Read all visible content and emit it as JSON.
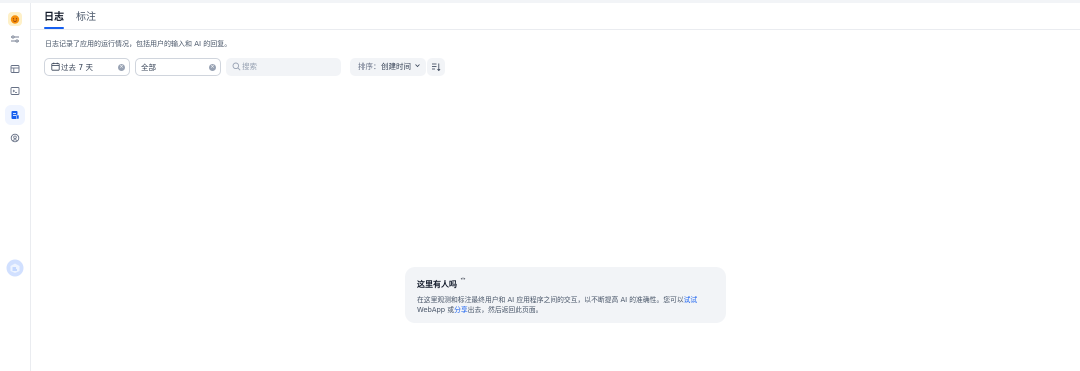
{
  "tabs": [
    {
      "label": "日志"
    },
    {
      "label": "标注"
    }
  ],
  "description": "日志记录了应用的运行情况，包括用户的输入和 AI 的回复。",
  "filters": {
    "period": "过去 7 天",
    "status": "全部",
    "search_placeholder": "搜索",
    "sort_label": "排序：",
    "sort_value": "创建时间"
  },
  "empty_state": {
    "title": "这里有人吗",
    "body_before": "在这里观测和标注最终用户和 AI 应用程序之间的交互，以不断提高 AI 的准确性。您可以",
    "link_try": "试试",
    "body_webapp": " WebApp 或",
    "link_share": "分享",
    "body_after": "出去，然后返回此页面。"
  },
  "icons": [
    "app-avatar-icon",
    "settings-sliders-icon",
    "layout-icon",
    "terminal-icon",
    "logs-icon",
    "annotation-icon",
    "user-avatar-icon",
    "calendar-icon",
    "search-icon",
    "chevron-down-icon",
    "sort-icon"
  ],
  "colors": {
    "accent": "#155eef",
    "active_bg": "#eff4ff",
    "border": "#d0d5dd",
    "card_bg": "#f2f4f7"
  }
}
